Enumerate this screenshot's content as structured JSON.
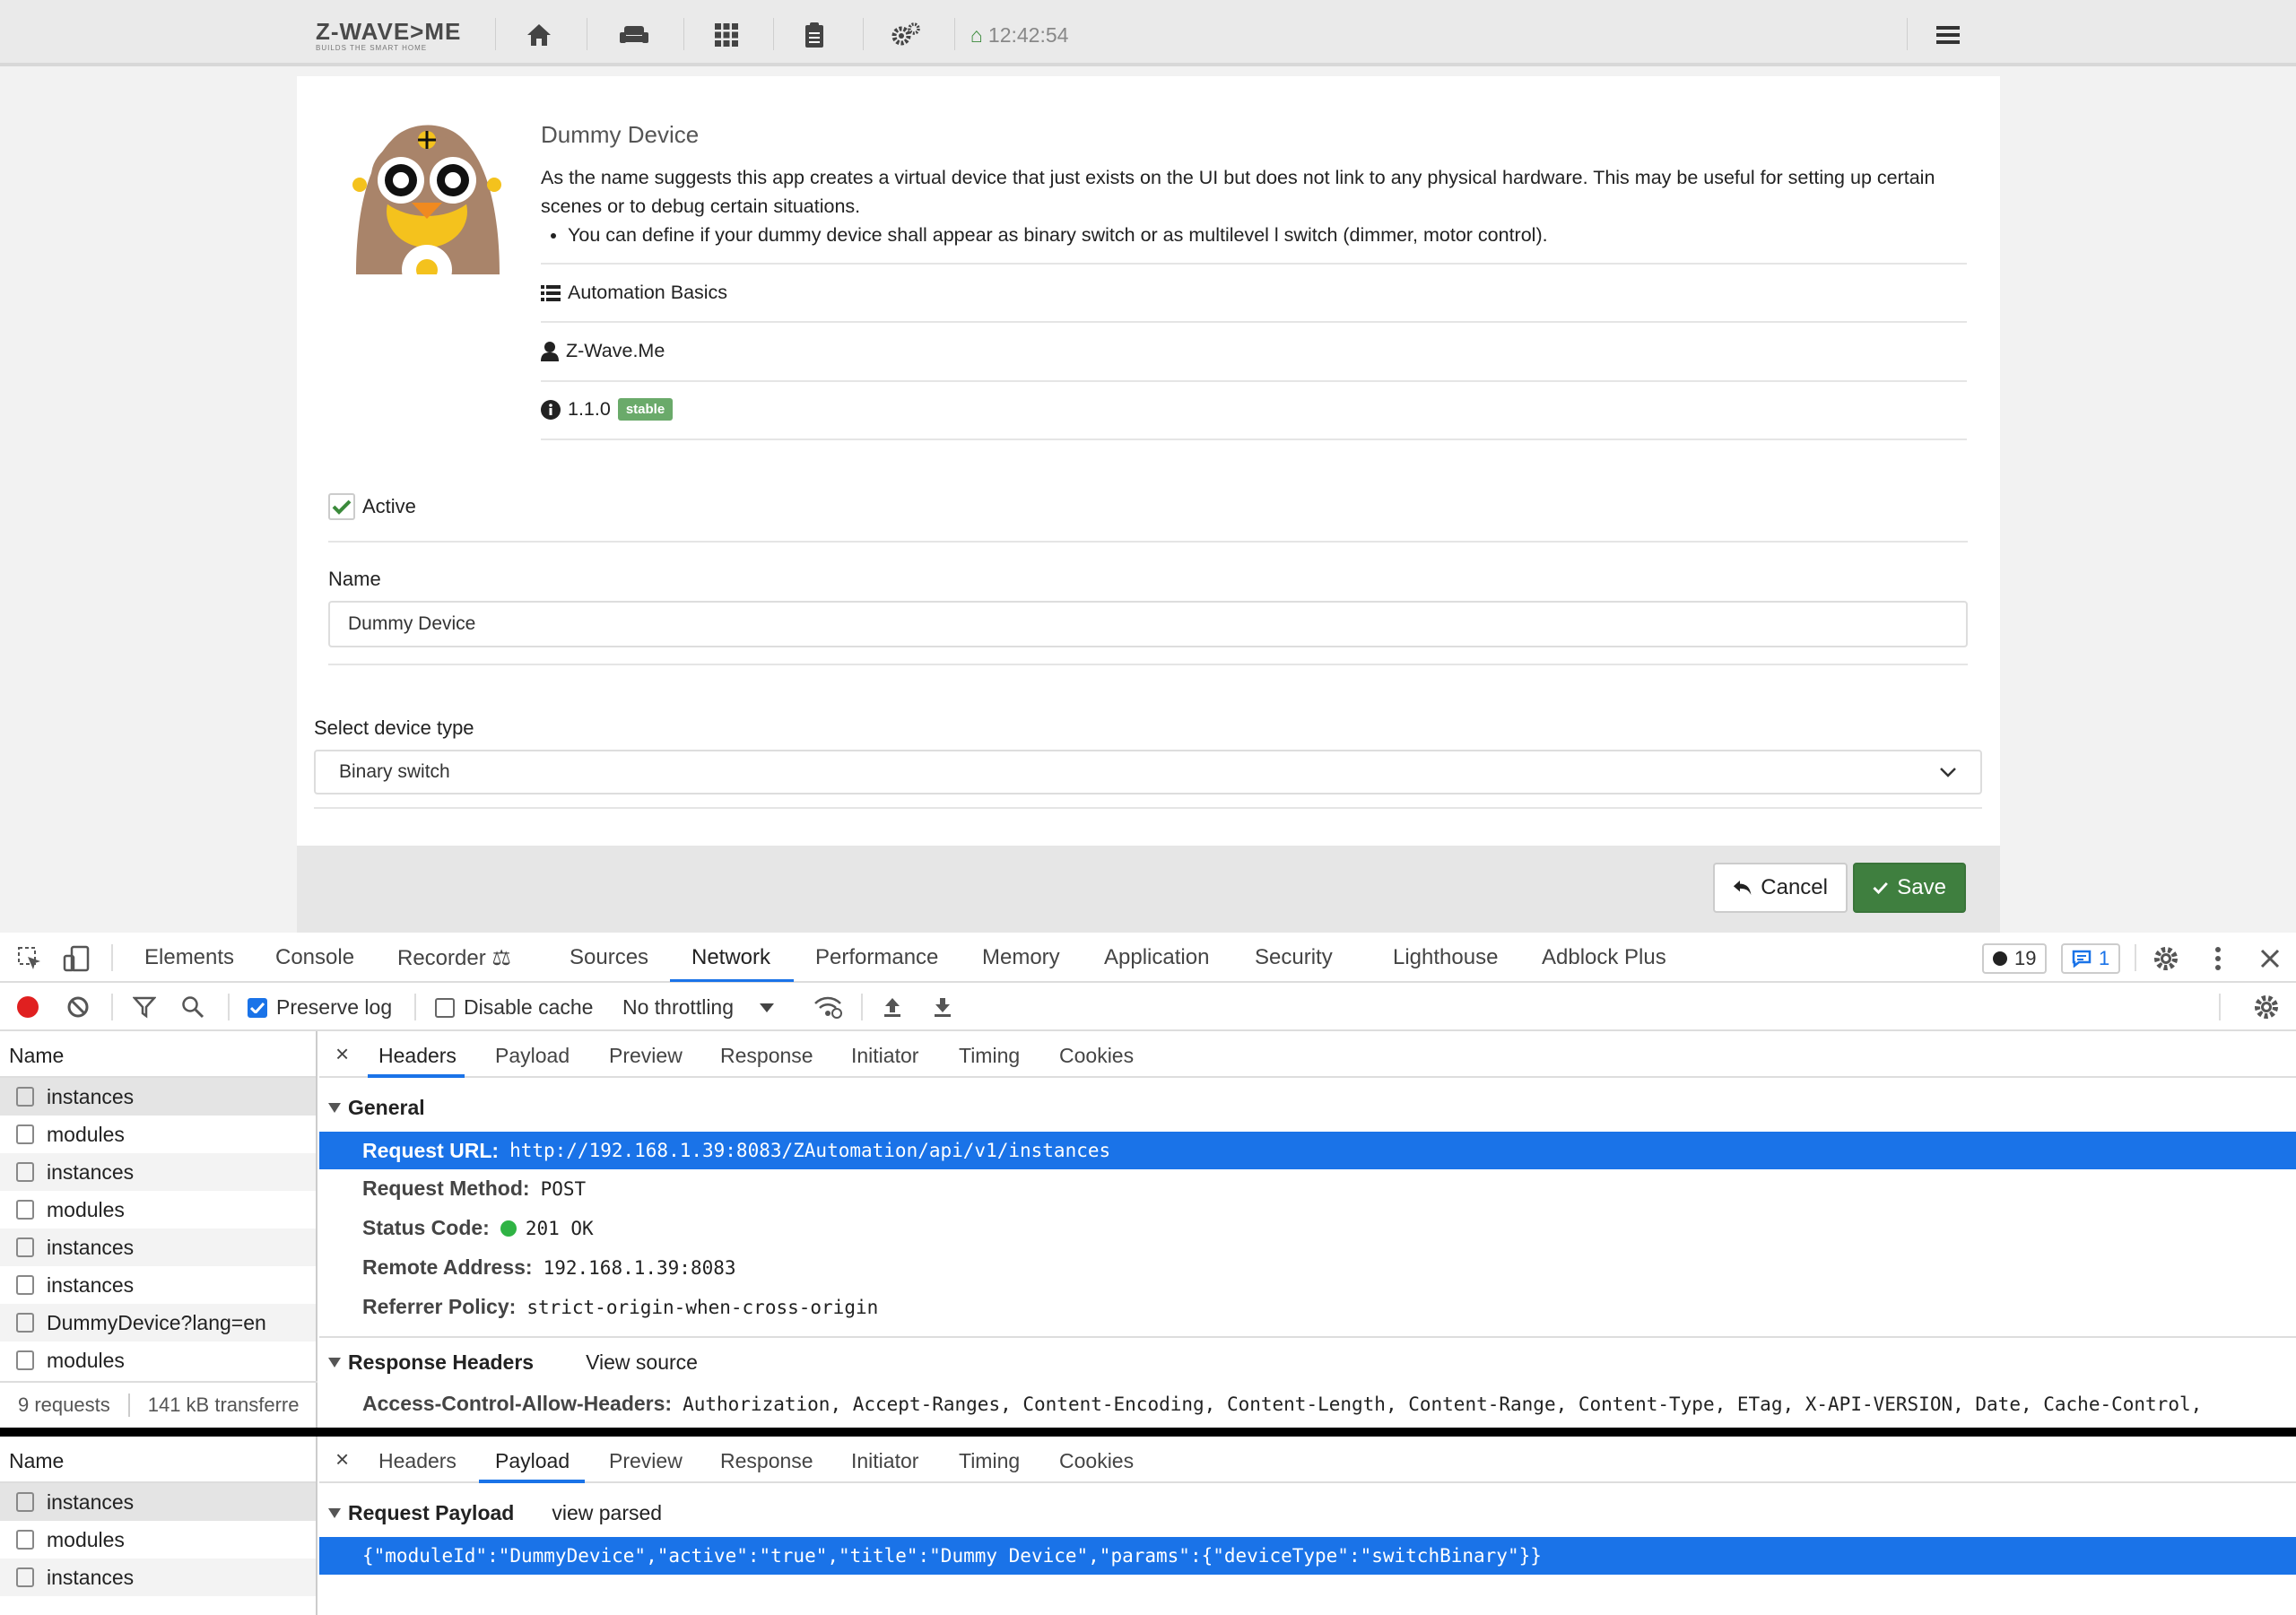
{
  "header": {
    "logo_text": "Z-WAVE>ME",
    "logo_tagline": "BUILDS THE SMART HOME",
    "clock": "12:42:54"
  },
  "app": {
    "title": "Dummy Device",
    "description": "As the name suggests this app creates a virtual device that just exists on the UI but does not link to any physical hardware. This may be useful for setting up certain scenes or to debug certain situations.",
    "bullet": "You can define if your dummy device shall appear as binary switch or as multilevel l switch (dimmer, motor control).",
    "category": "Automation Basics",
    "author": "Z-Wave.Me",
    "version": "1.1.0",
    "version_badge": "stable"
  },
  "form": {
    "active_label": "Active",
    "active_checked": true,
    "name_label": "Name",
    "name_value": "Dummy Device",
    "device_type_label": "Select device type",
    "device_type_value": "Binary switch",
    "cancel_label": "Cancel",
    "save_label": "Save"
  },
  "devtools": {
    "tabs": [
      "Elements",
      "Console",
      "Recorder",
      "Sources",
      "Network",
      "Performance",
      "Memory",
      "Application",
      "Security",
      "Lighthouse",
      "Adblock Plus"
    ],
    "active_tab": "Network",
    "issues_count": "19",
    "messages_count": "1",
    "toolbar": {
      "preserve_log": "Preserve log",
      "preserve_log_checked": true,
      "disable_cache": "Disable cache",
      "disable_cache_checked": false,
      "throttling": "No throttling"
    },
    "list_header": "Name",
    "requests_top": [
      "instances",
      "modules",
      "instances",
      "modules",
      "instances",
      "instances",
      "DummyDevice?lang=en",
      "modules"
    ],
    "requests_bottom": [
      "instances",
      "modules",
      "instances"
    ],
    "summary_requests": "9 requests",
    "summary_transfer": "141 kB transferre",
    "detail_tabs": [
      "Headers",
      "Payload",
      "Preview",
      "Response",
      "Initiator",
      "Timing",
      "Cookies"
    ],
    "close_glyph": "×",
    "headers": {
      "general_title": "General",
      "request_url_key": "Request URL:",
      "request_url": "http://192.168.1.39:8083/ZAutomation/api/v1/instances",
      "method_key": "Request Method:",
      "method": "POST",
      "status_key": "Status Code:",
      "status": "201 OK",
      "remote_key": "Remote Address:",
      "remote": "192.168.1.39:8083",
      "referrer_key": "Referrer Policy:",
      "referrer": "strict-origin-when-cross-origin",
      "response_headers_title": "Response Headers",
      "view_source": "View source",
      "acah_key": "Access-Control-Allow-Headers:",
      "acah": "Authorization, Accept-Ranges, Content-Encoding, Content-Length, Content-Range, Content-Type, ETag, X-API-VERSION, Date, Cache-Control,"
    },
    "payload": {
      "title": "Request Payload",
      "view_parsed": "view parsed",
      "body": "{\"moduleId\":\"DummyDevice\",\"active\":\"true\",\"title\":\"Dummy Device\",\"params\":{\"deviceType\":\"switchBinary\"}}"
    }
  },
  "colors": {
    "accent_blue": "#1a73e8",
    "save_green": "#3f7f3f",
    "badge_green": "#6aaa6a",
    "status_dot": "#2fb344"
  }
}
